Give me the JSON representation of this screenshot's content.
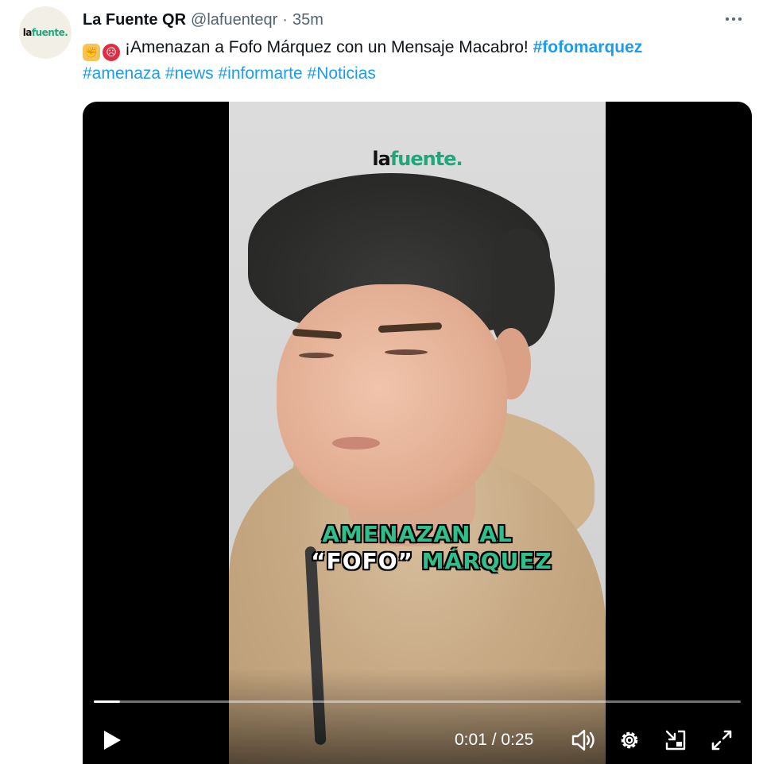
{
  "author": {
    "display_name": "La Fuente QR",
    "handle": "@lafuenteqr",
    "separator": "·",
    "time": "35m",
    "avatar_logo_main": "la",
    "avatar_logo_accent": "fuente.",
    "avatar_icon": "lafuente-logo-avatar"
  },
  "more_icon": "more-horizontal-icon",
  "tweet": {
    "emoji_1": "fist-emoji",
    "emoji_2": "angry-face-emoji",
    "text": "¡Amenazan a Fofo Márquez con un Mensaje Macabro! ",
    "hashtags": [
      "#fofomarquez",
      "#amenaza",
      "#news",
      "#informarte",
      "#Noticias"
    ]
  },
  "video": {
    "brand_main": "la",
    "brand_accent": "fuente.",
    "caption_line1": "AMENAZAN AL",
    "caption_line2_white": "“FOFO”",
    "caption_line2_green": "MÁRQUEZ",
    "current_time": "0:01",
    "time_separator": " / ",
    "duration": "0:25",
    "progress_fraction": 0.04,
    "controls": {
      "play": "play-icon",
      "volume": "volume-icon",
      "settings": "settings-gear-icon",
      "pip": "picture-in-picture-icon",
      "fullscreen": "fullscreen-icon"
    }
  },
  "colors": {
    "hashtag": "#1d9bf0",
    "text": "#0f1419",
    "muted": "#536471",
    "caption_green": "#2fbf8a"
  }
}
